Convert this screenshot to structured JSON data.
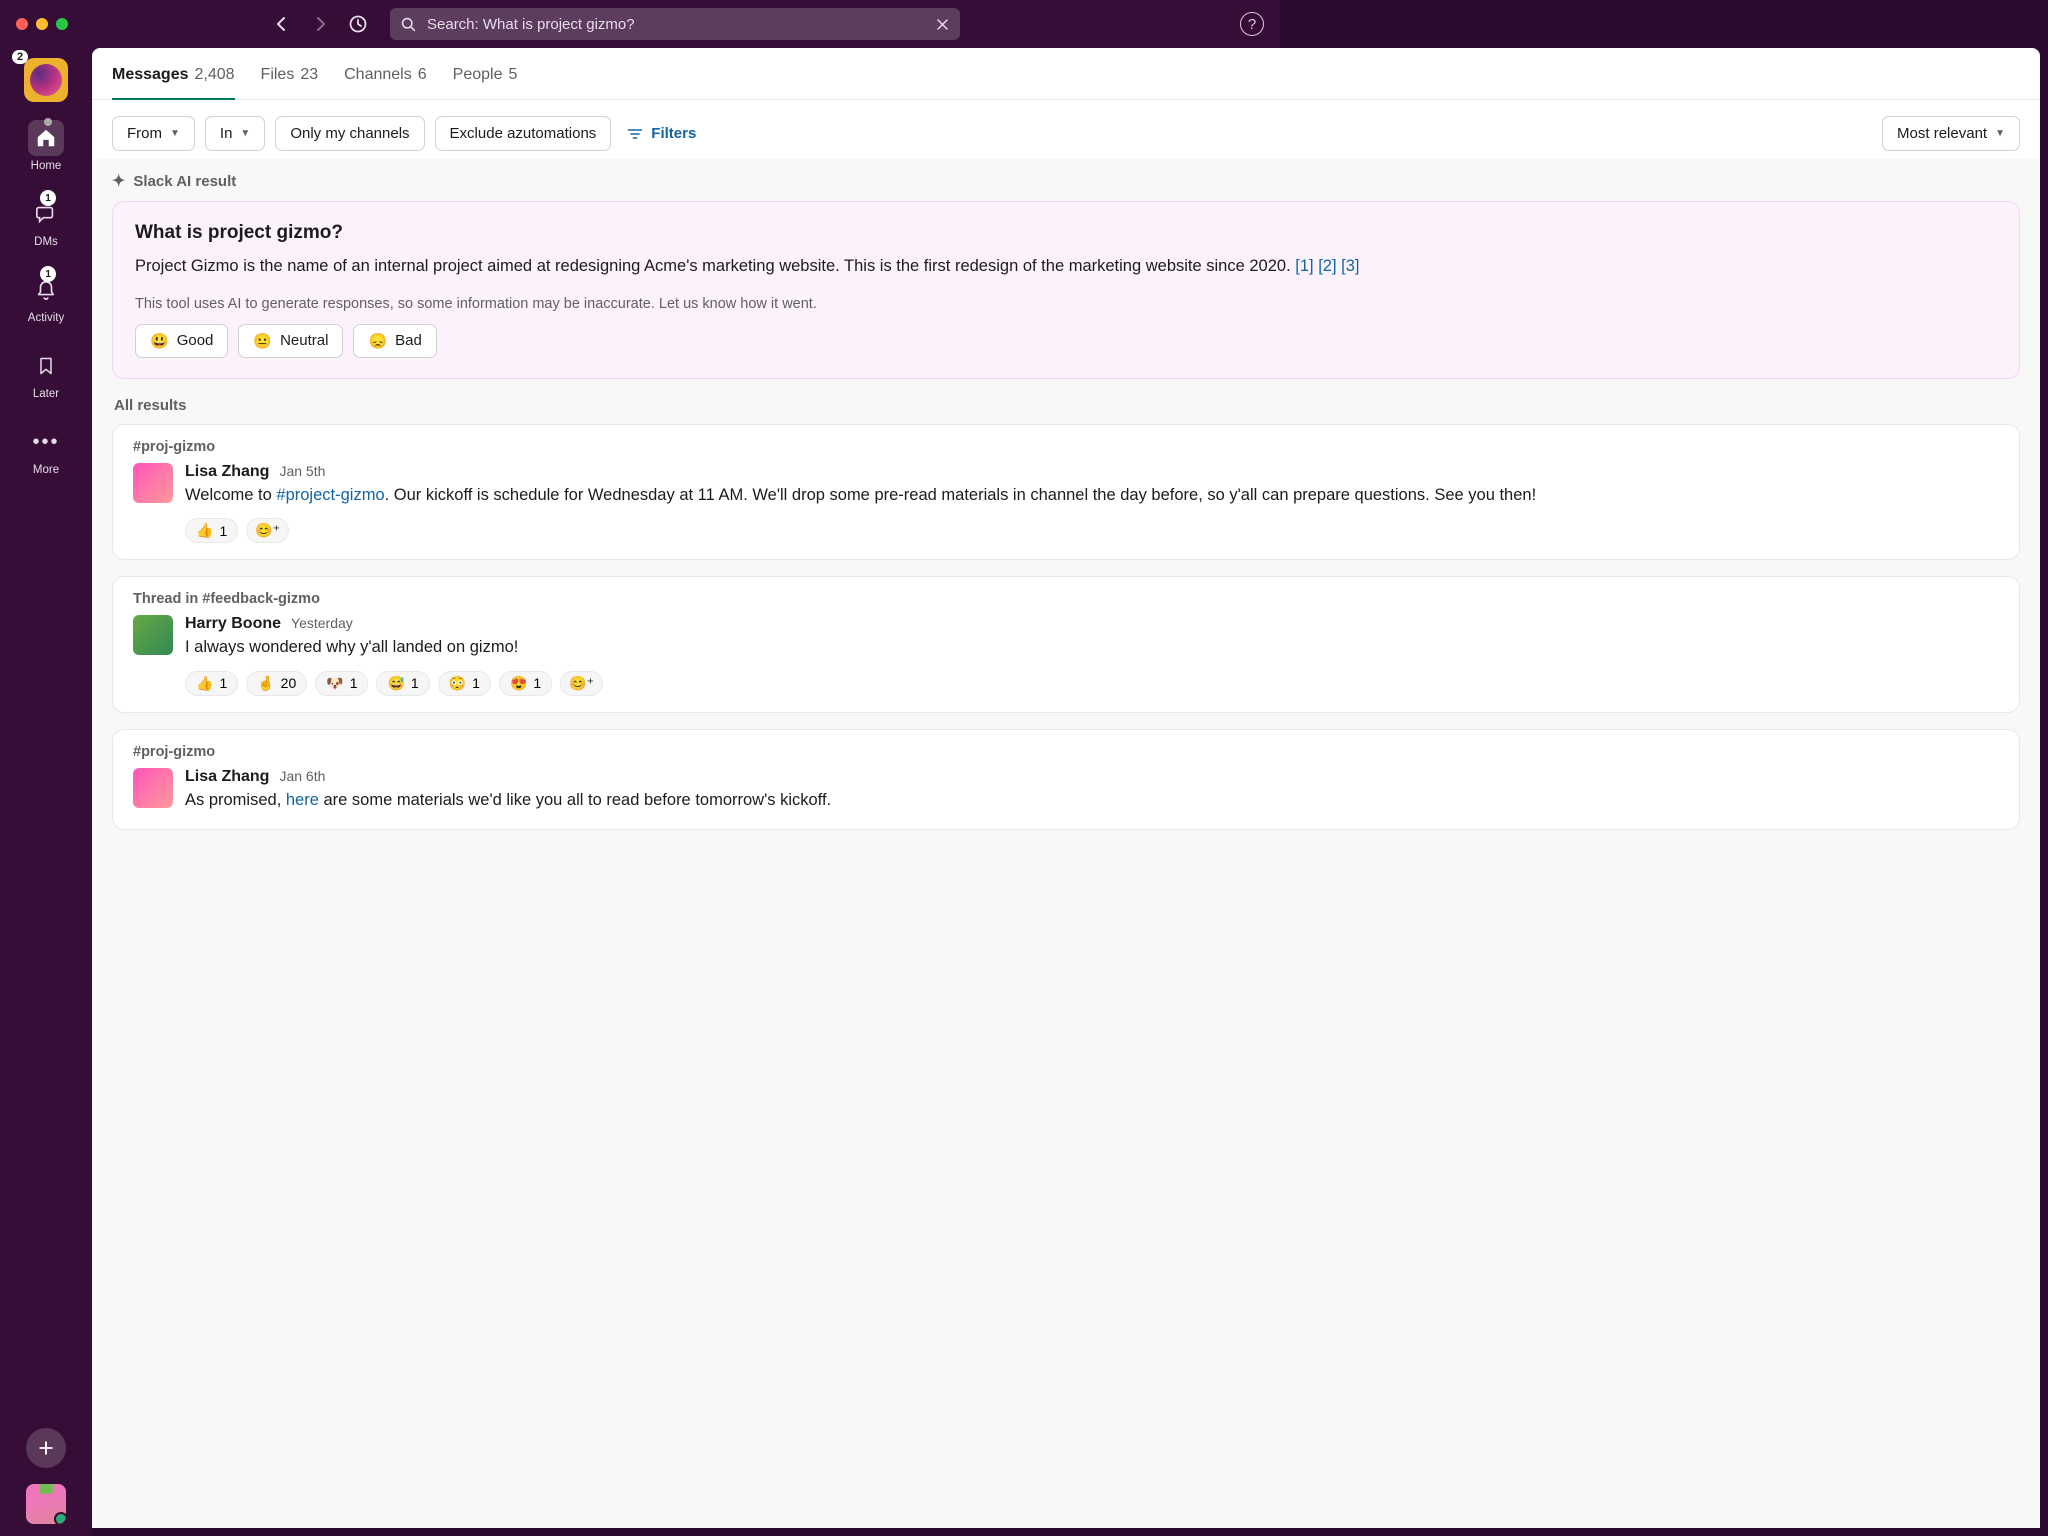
{
  "search": {
    "placeholder": "Search",
    "value": "Search: What is project gizmo?"
  },
  "workspace": {
    "badge": "2"
  },
  "nav": {
    "home": {
      "label": "Home"
    },
    "dms": {
      "label": "DMs",
      "badge": "1"
    },
    "activity": {
      "label": "Activity",
      "badge": "1"
    },
    "later": {
      "label": "Later"
    },
    "more": {
      "label": "More"
    }
  },
  "tabs": {
    "messages": {
      "label": "Messages",
      "count": "2,408"
    },
    "files": {
      "label": "Files",
      "count": "23"
    },
    "channels": {
      "label": "Channels",
      "count": "6"
    },
    "people": {
      "label": "People",
      "count": "5"
    }
  },
  "filters": {
    "from": "From",
    "in": "In",
    "only_my_channels": "Only my channels",
    "exclude_automations": "Exclude azutomations",
    "filters_label": "Filters",
    "sort": "Most relevant"
  },
  "ai": {
    "result_label": "Slack AI result",
    "title": "What is project gizmo?",
    "body_pre": "Project Gizmo is the name of an internal project aimed at redesigning Acme's marketing website. This is the first redesign of the marketing website since 2020. ",
    "citations": [
      "[1]",
      "[2]",
      "[3]"
    ],
    "disclaimer": "This tool uses AI to generate responses, so some information may be inaccurate. Let us know how it went.",
    "feedback": {
      "good": "Good",
      "neutral": "Neutral",
      "bad": "Bad"
    }
  },
  "all_results_label": "All results",
  "results": [
    {
      "channel": "#proj-gizmo",
      "author": "Lisa Zhang",
      "time": "Jan 5th",
      "text_pre": "Welcome to ",
      "text_link": "#project-gizmo",
      "text_post": ". Our kickoff is schedule for Wednesday at 11 AM. We'll drop some pre-read materials in channel the day before, so y'all can prepare questions. See you then!",
      "reactions": [
        {
          "emoji": "👍",
          "count": "1"
        }
      ],
      "avatar_bg": "linear-gradient(135deg,#f5b,#f99)"
    },
    {
      "channel": "Thread in #feedback-gizmo",
      "author": "Harry Boone",
      "time": "Yesterday",
      "text_pre": "I always wondered why y'all landed on gizmo!",
      "text_link": "",
      "text_post": "",
      "reactions": [
        {
          "emoji": "👍",
          "count": "1"
        },
        {
          "emoji": "🤞",
          "count": "20"
        },
        {
          "emoji": "🐶",
          "count": "1"
        },
        {
          "emoji": "😅",
          "count": "1"
        },
        {
          "emoji": "😳",
          "count": "1"
        },
        {
          "emoji": "😍",
          "count": "1"
        }
      ],
      "avatar_bg": "linear-gradient(135deg,#6a4,#385)"
    },
    {
      "channel": "#proj-gizmo",
      "author": "Lisa Zhang",
      "time": "Jan 6th",
      "text_pre": "As promised, ",
      "text_link": "here",
      "text_post": " are some materials we'd like you all to read before tomorrow's kickoff.",
      "reactions": [],
      "avatar_bg": "linear-gradient(135deg,#f5b,#f99)"
    }
  ]
}
